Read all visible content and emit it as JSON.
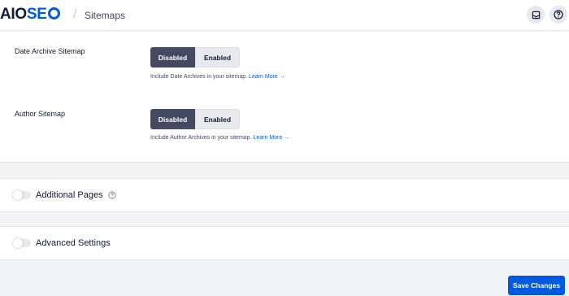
{
  "header": {
    "logo_main": "AIO",
    "logo_accent": "SE",
    "separator": "/",
    "breadcrumb": "Sitemaps"
  },
  "settings": {
    "date_archive": {
      "label": "Date Archive Sitemap",
      "options": [
        "Disabled",
        "Enabled"
      ],
      "selected": "Disabled",
      "help_text": "Include Date Archives in your sitemap.",
      "help_link": "Learn More →"
    },
    "author": {
      "label": "Author Sitemap",
      "options": [
        "Disabled",
        "Enabled"
      ],
      "selected": "Disabled",
      "help_text": "Include Author Archives in your sitemap.",
      "help_link": "Learn More →"
    }
  },
  "cards": {
    "additional_pages": {
      "title": "Additional Pages",
      "enabled": false
    },
    "advanced_settings": {
      "title": "Advanced Settings",
      "enabled": false
    }
  },
  "footer": {
    "save_label": "Save Changes"
  },
  "colors": {
    "brand": "#005ae0",
    "active_toggle": "#434960",
    "text": "#141b38"
  },
  "icons": {
    "inbox": "inbox-icon",
    "help": "help-circle-icon"
  }
}
